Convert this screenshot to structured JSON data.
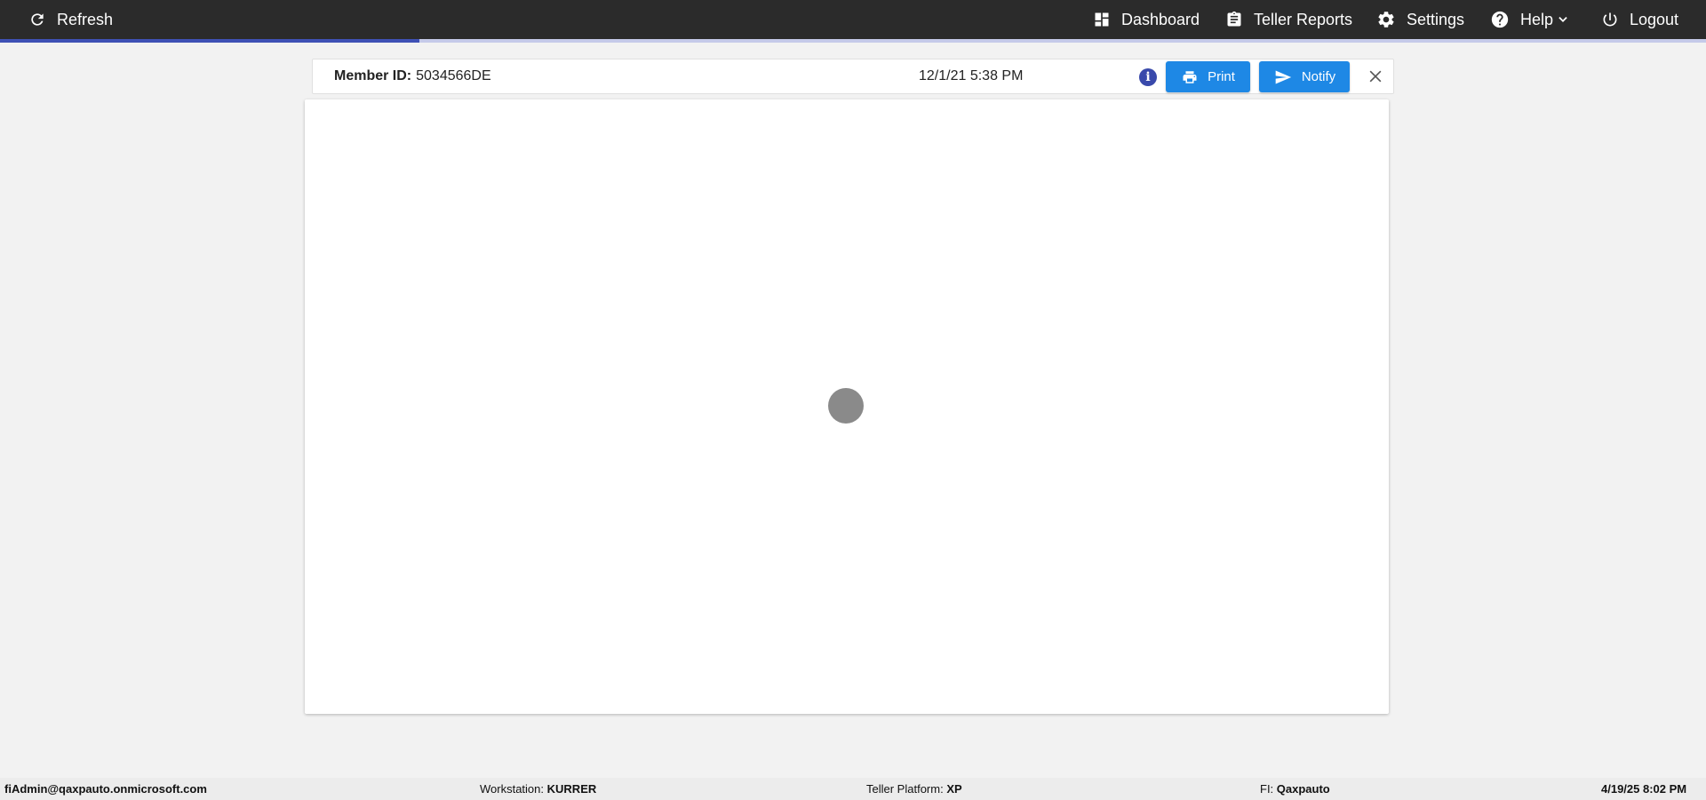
{
  "topbar": {
    "refresh_label": "Refresh",
    "dashboard_label": "Dashboard",
    "teller_reports_label": "Teller Reports",
    "settings_label": "Settings",
    "help_label": "Help",
    "logout_label": "Logout"
  },
  "progress": {
    "fraction": 0.246,
    "fill_color": "#3f51b5"
  },
  "doc_header": {
    "member_id_key": "Member ID:",
    "member_id_value": "5034566DE",
    "date": "12/1/21 5:38 PM",
    "info_icon": "info-icon",
    "print_label": "Print",
    "notify_label": "Notify",
    "button_color": "#1e88e5"
  },
  "footer": {
    "user": "fiAdmin@qaxpauto.onmicrosoft.com",
    "workstation_key": "Workstation:",
    "workstation_value": "KURRER",
    "teller_platform_key": "Teller Platform:",
    "teller_platform_value": "XP",
    "fi_key": "FI:",
    "fi_value": "Qaxpauto",
    "datetime": "4/19/25 8:02 PM"
  }
}
